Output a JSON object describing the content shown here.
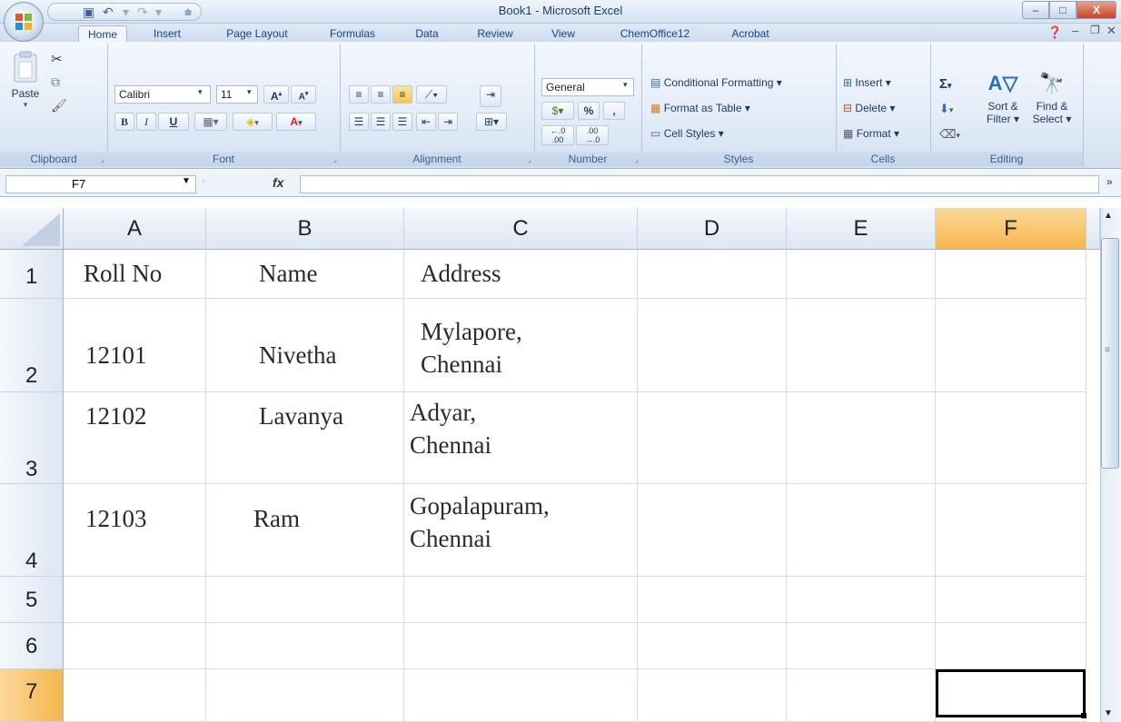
{
  "window": {
    "title": "Book1 - Microsoft Excel",
    "minimize": "–",
    "maximize": "□",
    "close": "X"
  },
  "tabs": [
    {
      "label": "Home",
      "active": true
    },
    {
      "label": "Insert"
    },
    {
      "label": "Page Layout"
    },
    {
      "label": "Formulas"
    },
    {
      "label": "Data"
    },
    {
      "label": "Review"
    },
    {
      "label": "View"
    },
    {
      "label": "ChemOffice12"
    },
    {
      "label": "Acrobat"
    }
  ],
  "ribbon": {
    "clipboard": {
      "label": "Clipboard",
      "paste": "Paste"
    },
    "font": {
      "label": "Font",
      "name": "Calibri",
      "size": "11",
      "bold": "B",
      "italic": "I",
      "underline": "U"
    },
    "alignment": {
      "label": "Alignment"
    },
    "number": {
      "label": "Number",
      "format": "General",
      "percent": "%",
      "comma": ",",
      "inc_dec": ".0 .00",
      "dec_dec": ".00 .0"
    },
    "styles": {
      "label": "Styles",
      "conditional": "Conditional Formatting ▾",
      "format_table": "Format as Table ▾",
      "cell_styles": "Cell Styles ▾"
    },
    "cells": {
      "label": "Cells",
      "insert": "Insert ▾",
      "delete": "Delete ▾",
      "format": "Format ▾"
    },
    "editing": {
      "label": "Editing",
      "sort": "Sort &",
      "filter": "Filter ▾",
      "find": "Find &",
      "select": "Select ▾"
    }
  },
  "formula_bar": {
    "name_box": "F7",
    "fx": "fx",
    "content": ""
  },
  "columns": [
    "A",
    "B",
    "C",
    "D",
    "E",
    "F"
  ],
  "rows": [
    {
      "num": "1",
      "a": "Roll No",
      "b": "Name",
      "c1": "Address",
      "c2": ""
    },
    {
      "num": "2",
      "a": "12101",
      "b": "Nivetha",
      "c1": "Mylapore,",
      "c2": "Chennai"
    },
    {
      "num": "3",
      "a": "12102",
      "b": "Lavanya",
      "c1": "Adyar,",
      "c2": "Chennai"
    },
    {
      "num": "4",
      "a": "12103",
      "b": "Ram",
      "c1": "Gopalapuram,",
      "c2": "Chennai"
    },
    {
      "num": "5"
    },
    {
      "num": "6"
    },
    {
      "num": "7"
    }
  ],
  "selected_cell": "F7"
}
